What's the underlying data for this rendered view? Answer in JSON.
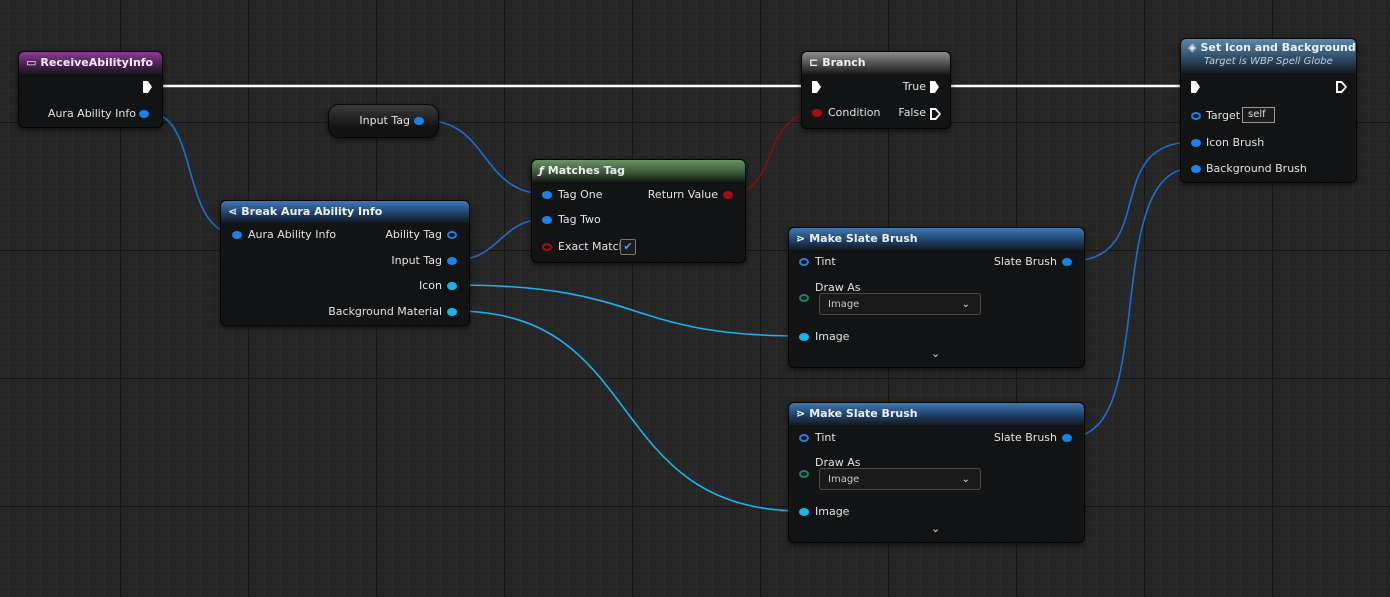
{
  "nodes": {
    "receive": {
      "title": "ReceiveAbilityInfo",
      "pin_out": "Aura Ability Info"
    },
    "input_tag_var": {
      "label": "Input Tag"
    },
    "break": {
      "title": "Break Aura Ability Info",
      "pin_in": "Aura Ability Info",
      "out_ability_tag": "Ability Tag",
      "out_input_tag": "Input Tag",
      "out_icon": "Icon",
      "out_bg": "Background Material"
    },
    "matches": {
      "title": "Matches Tag",
      "tag_one": "Tag One",
      "tag_two": "Tag Two",
      "exact": "Exact Match",
      "exact_checked": true,
      "return": "Return Value"
    },
    "branch": {
      "title": "Branch",
      "condition": "Condition",
      "true": "True",
      "false": "False"
    },
    "set_icon": {
      "title": "Set Icon and Background",
      "subtitle": "Target is WBP Spell Globe",
      "target": "Target",
      "target_value": "self",
      "icon_brush": "Icon Brush",
      "bg_brush": "Background Brush"
    },
    "brush1": {
      "title": "Make Slate Brush",
      "tint": "Tint",
      "draw_as": "Draw As",
      "draw_as_value": "Image",
      "image": "Image",
      "out": "Slate Brush"
    },
    "brush2": {
      "title": "Make Slate Brush",
      "tint": "Tint",
      "draw_as": "Draw As",
      "draw_as_value": "Image",
      "image": "Image",
      "out": "Slate Brush"
    }
  },
  "colors": {
    "exec": "#ffffff",
    "struct": "#1a82ea",
    "object": "#1ab2ee",
    "bool": "#a20f0f",
    "background": "#262626"
  }
}
